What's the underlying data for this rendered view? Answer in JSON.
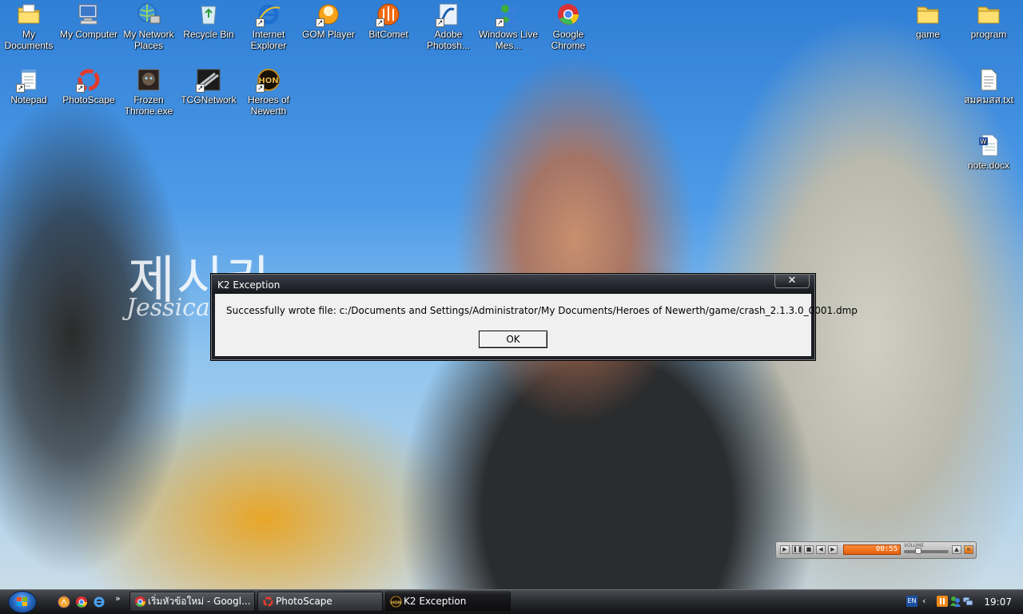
{
  "desktop": {
    "wallpaper_text": "제시카",
    "wallpaper_text2": "Jessica",
    "icons": [
      {
        "id": "my-documents",
        "label": "My Documents",
        "icon": "documents-folder-icon"
      },
      {
        "id": "my-computer",
        "label": "My Computer",
        "icon": "computer-icon"
      },
      {
        "id": "my-network-places",
        "label": "My Network Places",
        "icon": "network-globe-icon"
      },
      {
        "id": "recycle-bin",
        "label": "Recycle Bin",
        "icon": "recycle-bin-icon"
      },
      {
        "id": "internet-explorer",
        "label": "Internet Explorer",
        "icon": "internet-explorer-icon"
      },
      {
        "id": "gom-player",
        "label": "GOM Player",
        "icon": "gom-player-icon"
      },
      {
        "id": "bitcomet",
        "label": "BitComet",
        "icon": "bitcomet-icon"
      },
      {
        "id": "adobe-photoshop",
        "label": "Adobe Photosh...",
        "icon": "photoshop-icon"
      },
      {
        "id": "windows-live-messenger",
        "label": "Windows Live Mes...",
        "icon": "messenger-icon"
      },
      {
        "id": "google-chrome",
        "label": "Google Chrome",
        "icon": "chrome-icon"
      },
      {
        "id": "notepad",
        "label": "Notepad",
        "icon": "notepad-icon"
      },
      {
        "id": "photoscape",
        "label": "PhotoScape",
        "icon": "photoscape-icon"
      },
      {
        "id": "frozen-throne",
        "label": "Frozen Throne.exe",
        "icon": "frozen-throne-icon"
      },
      {
        "id": "tcgnetwork",
        "label": "TCGNetwork",
        "icon": "tcgnetwork-icon"
      },
      {
        "id": "heroes-of-newerth",
        "label": "Heroes of Newerth",
        "icon": "hon-icon"
      },
      {
        "id": "game",
        "label": "game",
        "icon": "folder-icon"
      },
      {
        "id": "program",
        "label": "program",
        "icon": "folder-icon"
      },
      {
        "id": "thai-txt",
        "label": "สมคมสส.txt",
        "icon": "text-file-icon"
      },
      {
        "id": "note-docx",
        "label": "note.docx",
        "icon": "word-document-icon"
      }
    ]
  },
  "dialog": {
    "title": "K2 Exception",
    "close_glyph": "✕",
    "message": "Successfully wrote file: c:/Documents and Settings/Administrator/My Documents/Heroes of Newerth/game/crash_2.1.3.0_0001.dmp",
    "ok_label": "OK"
  },
  "media_player": {
    "time": "00:55",
    "volume_label": "VOLUME",
    "controls": [
      "play",
      "pause",
      "stop",
      "previous",
      "next"
    ]
  },
  "taskbar": {
    "quick_launch_more": "»",
    "tasks": [
      {
        "label": "เริ่มหัวข้อใหม่ - Googl...",
        "icon": "chrome-icon",
        "active": false
      },
      {
        "label": "PhotoScape",
        "icon": "photoscape-icon",
        "active": false
      },
      {
        "label": "K2 Exception",
        "icon": "hon-icon",
        "active": true
      }
    ],
    "tray": {
      "language": "EN",
      "expand": "‹",
      "clock": "19:07"
    }
  }
}
